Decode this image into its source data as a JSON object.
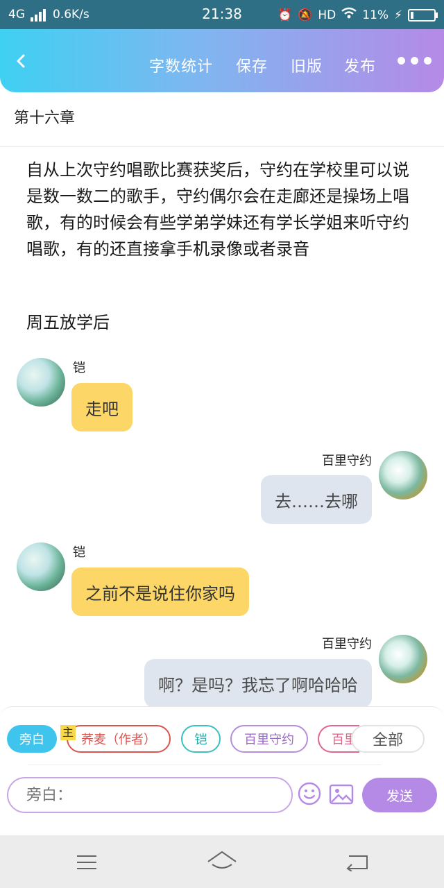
{
  "status": {
    "network": "4G",
    "speed": "0.6K/s",
    "time": "21:38",
    "hd": "HD",
    "battery": "11%",
    "battery_level": 0.11
  },
  "toolbar": {
    "word_count": "字数统计",
    "save": "保存",
    "old_version": "旧版",
    "publish": "发布"
  },
  "chapter": {
    "title": "第十六章"
  },
  "story": {
    "paragraph1": "自从上次守约唱歌比赛获奖后，守约在学校里可以说是数一数二的歌手，守约偶尔会在走廊还是操场上唱歌，有的时候会有些学弟学妹还有学长学姐来听守约唱歌，有的还直接拿手机录像或者录音",
    "paragraph2": "周五放学后"
  },
  "messages": [
    {
      "speaker": "铠",
      "text": "走吧"
    },
    {
      "speaker": "百里守约",
      "text": "去……去哪"
    },
    {
      "speaker": "铠",
      "text": "之前不是说住你家吗"
    },
    {
      "speaker": "百里守约",
      "text": "啊？是吗？我忘了啊哈哈哈"
    }
  ],
  "roles": {
    "narrator": "旁白",
    "main_badge": "主",
    "author": "荞麦（作者）",
    "kai": "铠",
    "baili": "百里守约",
    "baili_partial": "百里",
    "all": "全部"
  },
  "composer": {
    "placeholder": "旁白：",
    "send": "发送"
  }
}
